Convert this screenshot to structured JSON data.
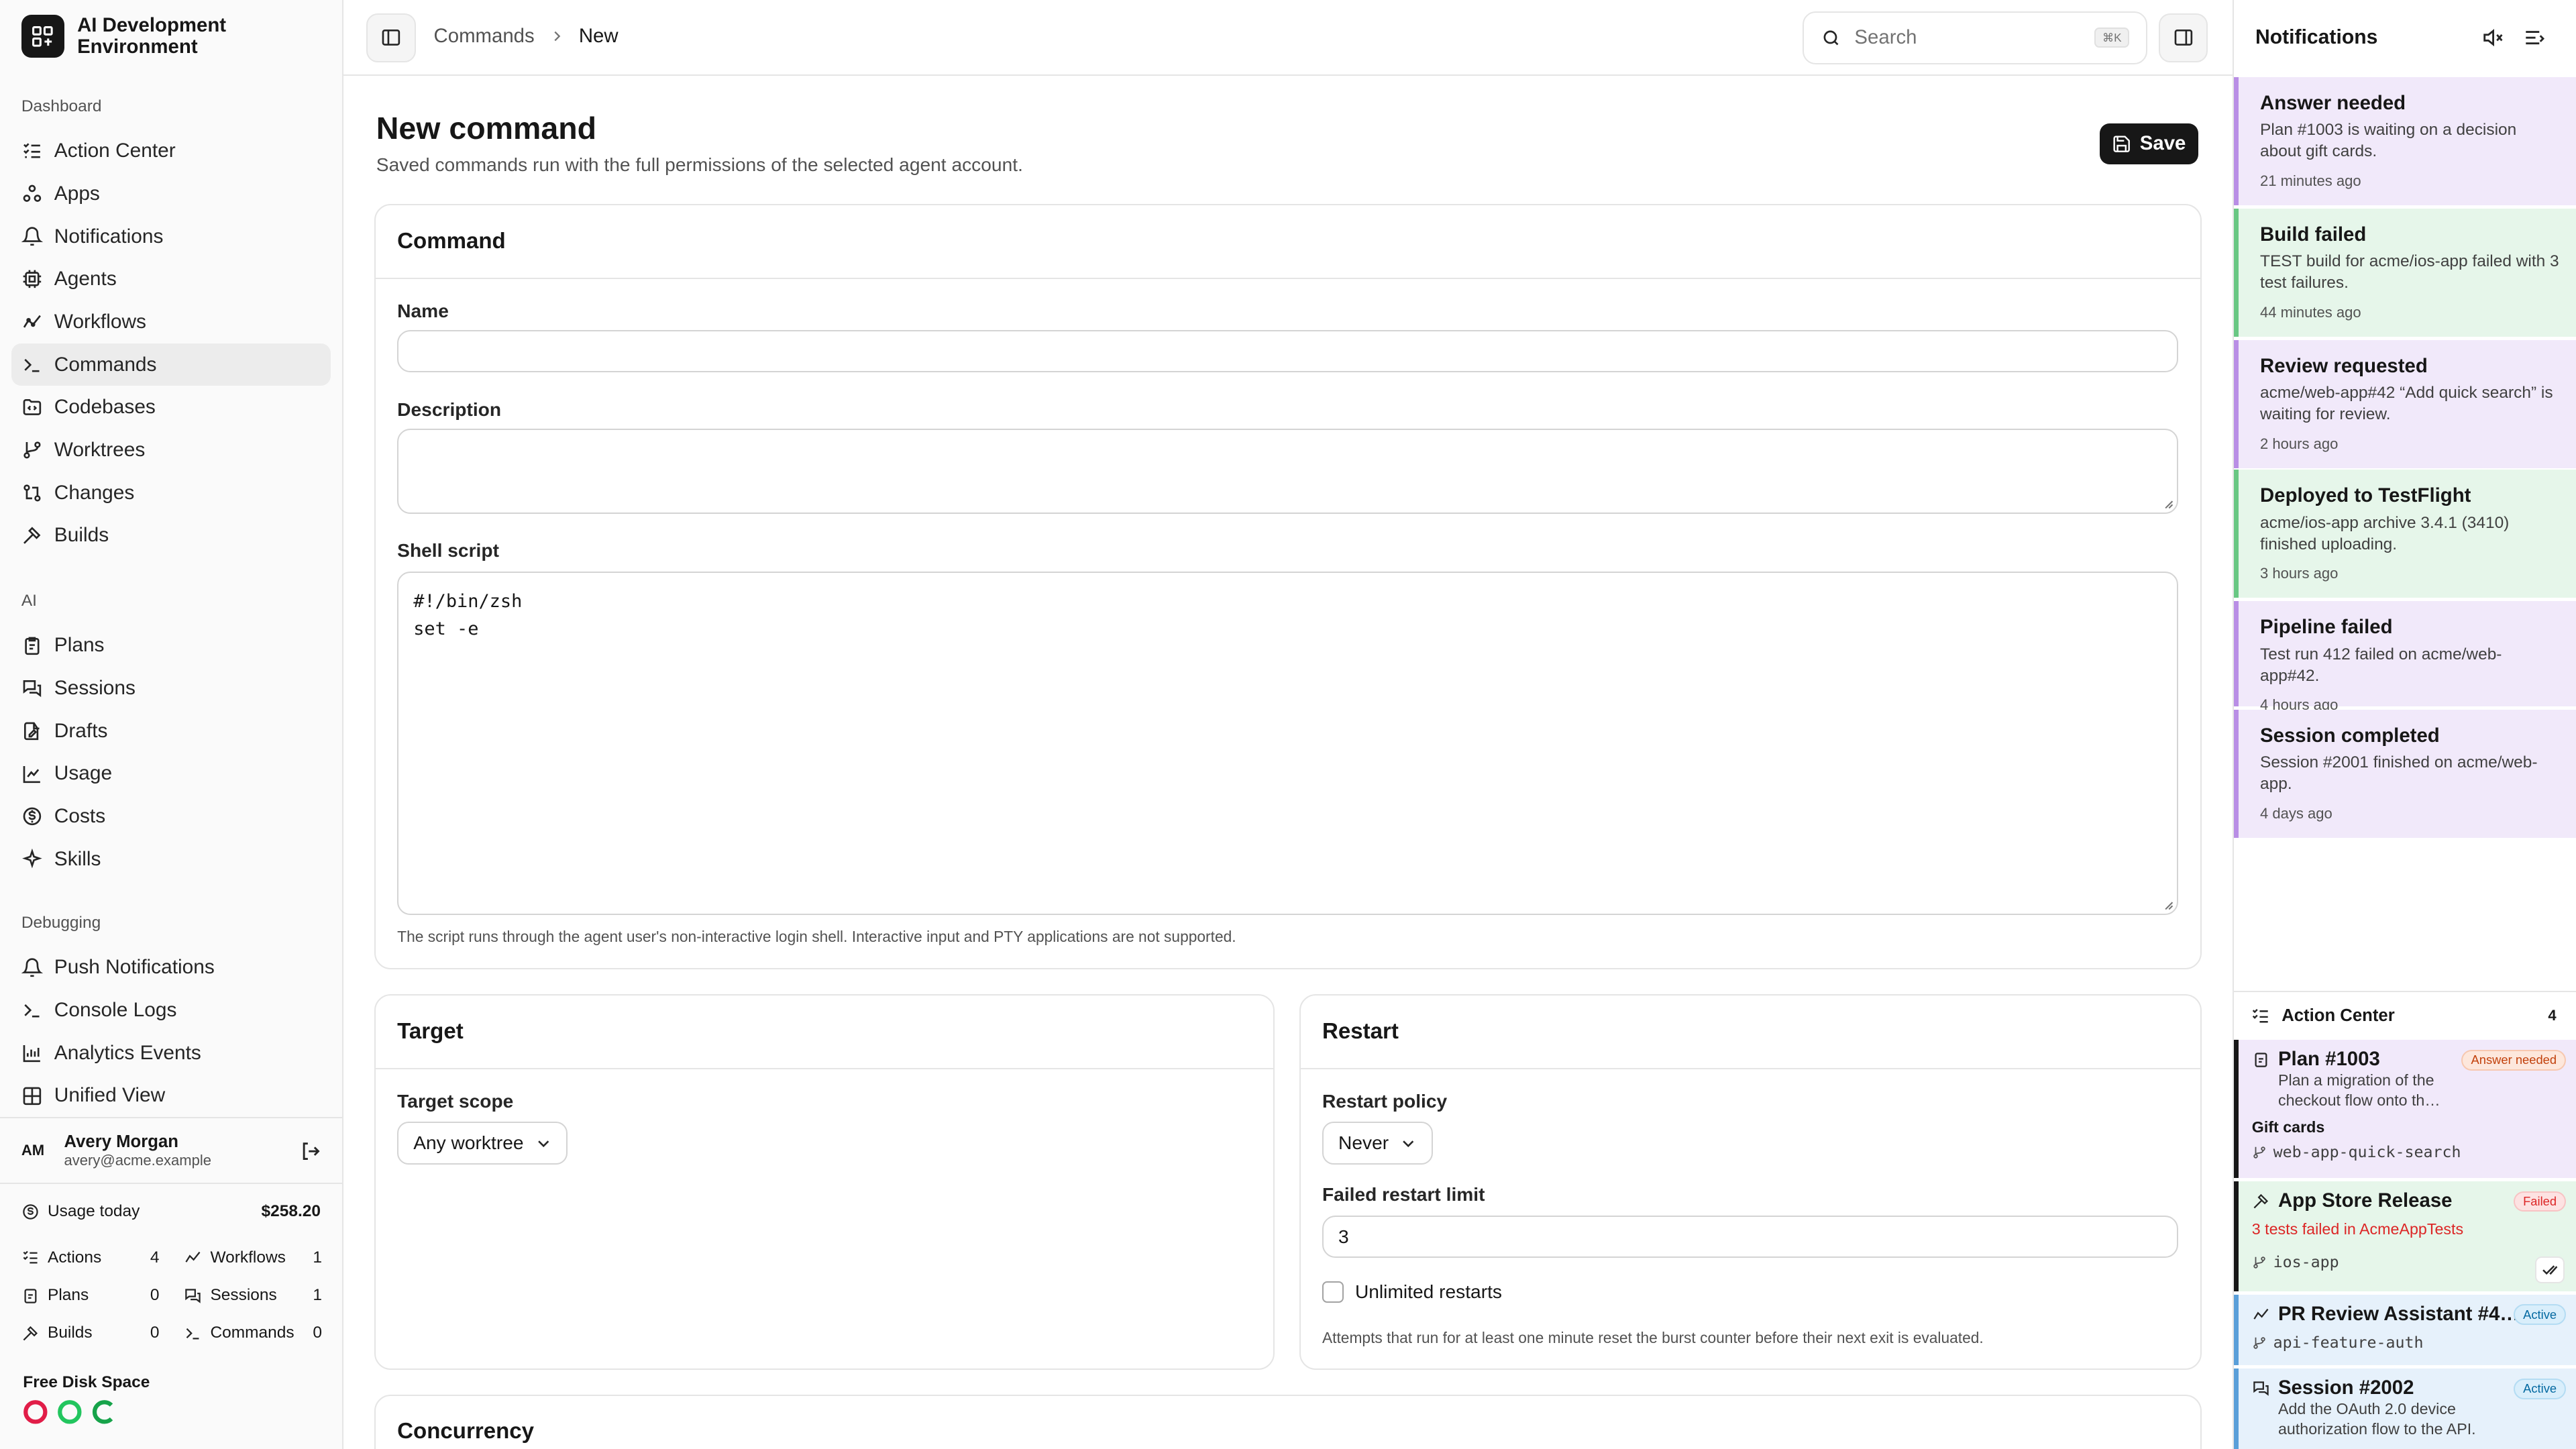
{
  "app": {
    "title": "AI Development Environment"
  },
  "sidebar": {
    "sections": [
      {
        "label": "Dashboard",
        "items": [
          {
            "label": "Action Center",
            "icon": "list-check-icon"
          },
          {
            "label": "Apps",
            "icon": "apps-icon"
          },
          {
            "label": "Notifications",
            "icon": "bell-icon"
          },
          {
            "label": "Agents",
            "icon": "cpu-icon"
          },
          {
            "label": "Workflows",
            "icon": "workflow-icon"
          },
          {
            "label": "Commands",
            "icon": "terminal-icon",
            "active": true
          },
          {
            "label": "Codebases",
            "icon": "folder-code-icon"
          },
          {
            "label": "Worktrees",
            "icon": "git-branch-icon"
          },
          {
            "label": "Changes",
            "icon": "git-compare-icon"
          },
          {
            "label": "Builds",
            "icon": "hammer-icon"
          }
        ]
      },
      {
        "label": "AI",
        "items": [
          {
            "label": "Plans",
            "icon": "clipboard-icon"
          },
          {
            "label": "Sessions",
            "icon": "messages-icon"
          },
          {
            "label": "Drafts",
            "icon": "file-edit-icon"
          },
          {
            "label": "Usage",
            "icon": "chart-icon"
          },
          {
            "label": "Costs",
            "icon": "dollar-icon"
          },
          {
            "label": "Skills",
            "icon": "sparkles-icon"
          }
        ]
      },
      {
        "label": "Debugging",
        "items": [
          {
            "label": "Push Notifications",
            "icon": "bell-ring-icon"
          },
          {
            "label": "Console Logs",
            "icon": "terminal-icon"
          },
          {
            "label": "Analytics Events",
            "icon": "activity-icon"
          },
          {
            "label": "Unified View",
            "icon": "layout-icon"
          }
        ]
      }
    ],
    "user": {
      "initials": "AM",
      "name": "Avery Morgan",
      "email": "avery@acme.example"
    },
    "usage": {
      "label": "Usage today",
      "value": "$258.20"
    },
    "stats": [
      {
        "label": "Actions",
        "value": "4"
      },
      {
        "label": "Workflows",
        "value": "1"
      },
      {
        "label": "Plans",
        "value": "0"
      },
      {
        "label": "Sessions",
        "value": "1"
      },
      {
        "label": "Builds",
        "value": "0"
      },
      {
        "label": "Commands",
        "value": "0"
      }
    ],
    "disk": {
      "label": "Free Disk Space",
      "colors": [
        "#e11d48",
        "#22c55e",
        "#16a34a"
      ]
    }
  },
  "topbar": {
    "breadcrumb": [
      "Commands",
      "New"
    ],
    "search_placeholder": "Search",
    "search_shortcut": "⌘K"
  },
  "page": {
    "title": "New command",
    "subtitle": "Saved commands run with the full permissions of the selected agent account.",
    "save_label": "Save",
    "command_card": {
      "title": "Command",
      "name_label": "Name",
      "name_value": "",
      "description_label": "Description",
      "description_value": "",
      "script_label": "Shell script",
      "script_value": "#!/bin/zsh\nset -e",
      "script_hint": "The script runs through the agent user's non-interactive login shell. Interactive input and PTY applications are not supported."
    },
    "target_card": {
      "title": "Target",
      "scope_label": "Target scope",
      "scope_value": "Any worktree"
    },
    "restart_card": {
      "title": "Restart",
      "policy_label": "Restart policy",
      "policy_value": "Never",
      "limit_label": "Failed restart limit",
      "limit_value": "3",
      "unlimited_label": "Unlimited restarts",
      "hint": "Attempts that run for at least one minute reset the burst counter before their next exit is evaluated."
    },
    "concurrency_card": {
      "title": "Concurrency"
    }
  },
  "notifications": {
    "title": "Notifications",
    "items": [
      {
        "title": "Answer needed",
        "body": "Plan #1003 is waiting on a decision about gift cards.",
        "time": "21 minutes ago",
        "tone": "purple"
      },
      {
        "title": "Build failed",
        "body": "TEST build for acme/ios-app failed with 3 test failures.",
        "time": "44 minutes ago",
        "tone": "green"
      },
      {
        "title": "Review requested",
        "body": "acme/web-app#42 “Add quick search” is waiting for review.",
        "time": "2 hours ago",
        "tone": "purple"
      },
      {
        "title": "Deployed to TestFlight",
        "body": "acme/ios-app archive 3.4.1 (3410) finished uploading.",
        "time": "3 hours ago",
        "tone": "green"
      },
      {
        "title": "Pipeline failed",
        "body": "Test run 412 failed on acme/web-app#42.",
        "time": "4 hours ago",
        "tone": "purple"
      },
      {
        "title": "Session completed",
        "body": "Session #2001 finished on acme/web-app.",
        "time": "4 days ago",
        "tone": "purple"
      }
    ],
    "action_center": {
      "title": "Action Center",
      "count": "4",
      "items": [
        {
          "title": "Plan #1003",
          "badge": "Answer needed",
          "desc": "Plan a migration of the checkout flow onto th…",
          "extra": "Gift cards",
          "branch": "web-app-quick-search"
        },
        {
          "title": "App Store Release",
          "badge": "Failed",
          "error": "3 tests failed in AcmeAppTests",
          "branch": "ios-app"
        },
        {
          "title": "PR Review Assistant #4…",
          "badge": "Active",
          "branch": "api-feature-auth"
        },
        {
          "title": "Session #2002",
          "badge": "Active",
          "desc": "Add the OAuth 2.0 device authorization flow to the API."
        }
      ]
    }
  }
}
